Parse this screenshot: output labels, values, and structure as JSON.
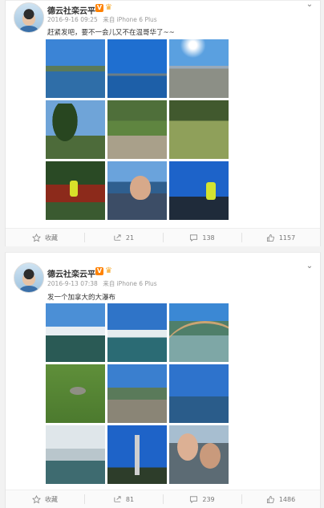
{
  "posts": [
    {
      "user_name": "德云社栾云平",
      "verified_badge": "V",
      "timestamp": "2016-9-16 09:25",
      "source": "来自 iPhone 6 Plus",
      "text": "赶紧发吧，要不一会儿又不在温哥华了~~",
      "photos": [
        "harbor-view",
        "sea-view",
        "park-bench",
        "tall-tree",
        "park-bench-man",
        "lawn-bird",
        "flowers-man",
        "selfie",
        "railing-man"
      ],
      "actions": {
        "collect": "收藏",
        "forward": "21",
        "comment": "138",
        "like": "1157"
      }
    },
    {
      "user_name": "德云社栾云平",
      "verified_badge": "V",
      "timestamp": "2016-9-13 07:38",
      "source": "来自 iPhone 6 Plus",
      "text": "发一个加拿大的大瀑布",
      "photos": [
        "falls-1",
        "falls-2",
        "rainbow",
        "bird-grass",
        "rock",
        "bay",
        "mist",
        "tower",
        "duo-selfie"
      ],
      "actions": {
        "collect": "收藏",
        "forward": "81",
        "comment": "239",
        "like": "1486"
      }
    }
  ],
  "colors": {
    "badge": "#ff8200",
    "crown": "#f6a623",
    "muted": "#999999"
  },
  "icons": {
    "collect": "star-icon",
    "forward": "share-icon",
    "comment": "comment-icon",
    "like": "thumbs-up-icon",
    "menu": "chevron-down-icon"
  }
}
